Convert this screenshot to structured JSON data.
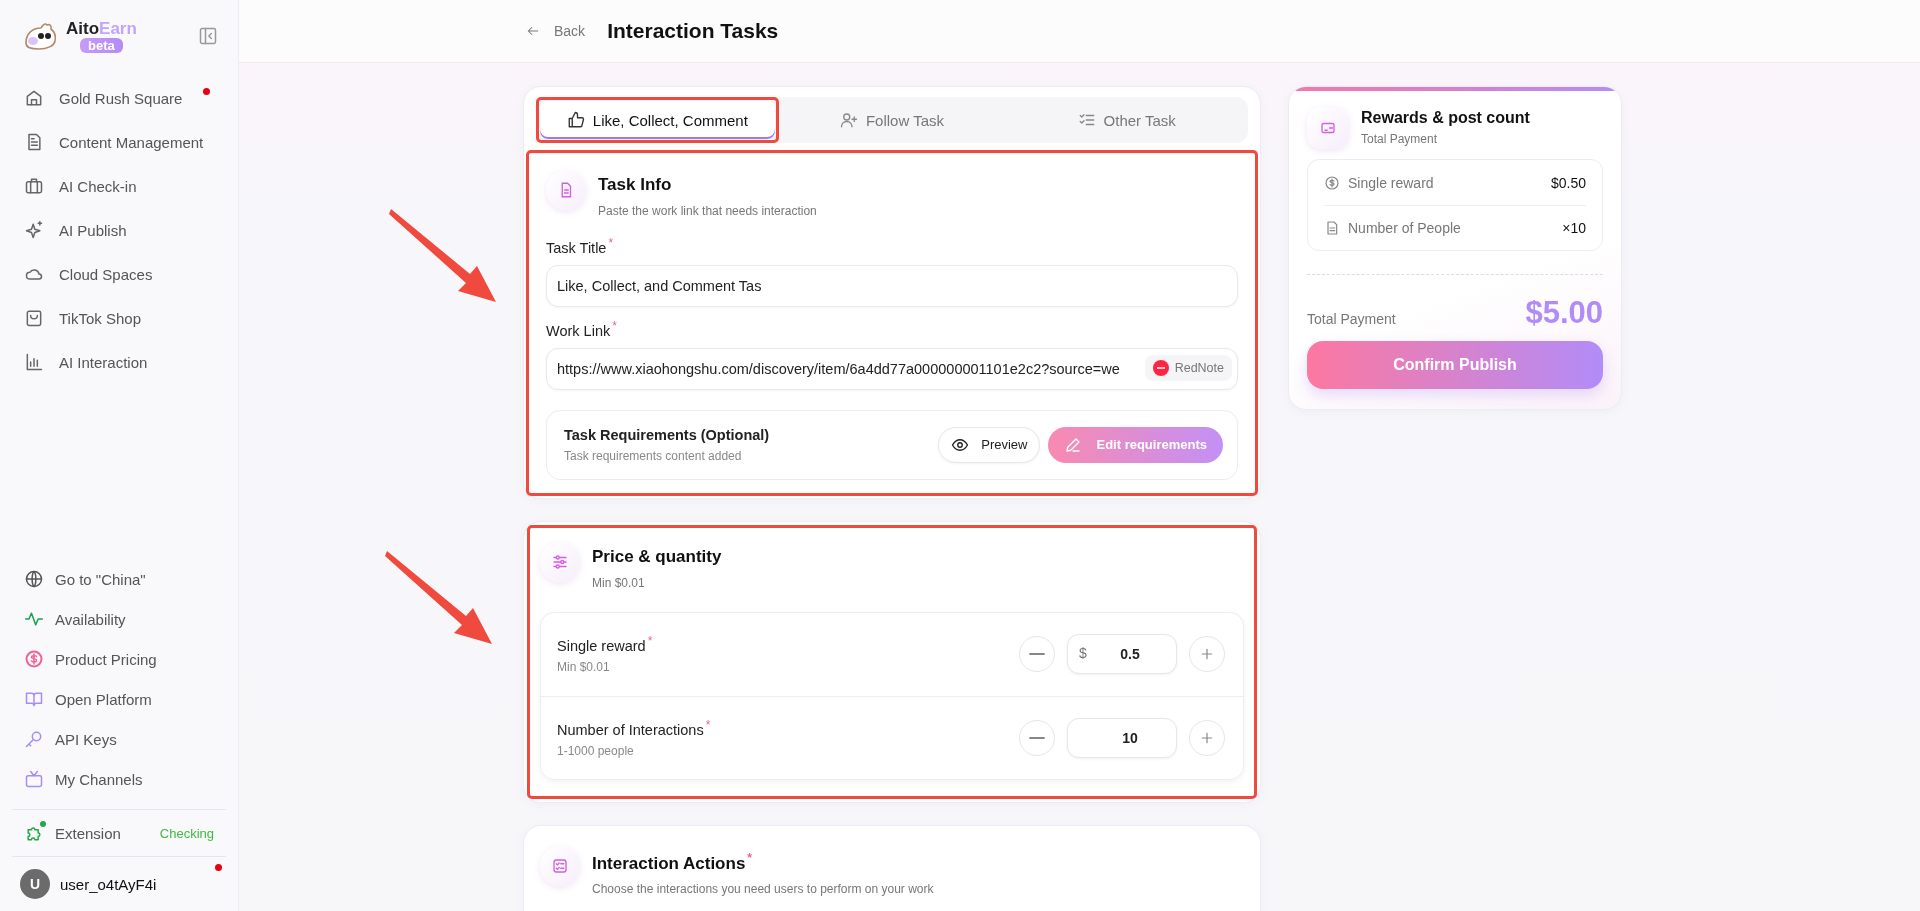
{
  "sidebar": {
    "logo": {
      "word_1": "Aito",
      "word_2": "Earn",
      "badge": "beta"
    },
    "nav_items": [
      {
        "label": "Gold Rush Square",
        "dot": true
      },
      {
        "label": "Content Management",
        "dot": false
      },
      {
        "label": "AI Check-in",
        "dot": false
      },
      {
        "label": "AI Publish",
        "dot": false
      },
      {
        "label": "Cloud Spaces",
        "dot": false
      },
      {
        "label": "TikTok Shop",
        "dot": false
      },
      {
        "label": "AI Interaction",
        "dot": false
      }
    ],
    "bottom_items": [
      {
        "label": "Go to \"China\"",
        "color": "#555555"
      },
      {
        "label": "Availability",
        "color": "#16a34a"
      },
      {
        "label": "Product Pricing",
        "color": "#f06292"
      },
      {
        "label": "Open Platform",
        "color": "#a78bfa"
      },
      {
        "label": "API Keys",
        "color": "#a78bfa"
      },
      {
        "label": "My Channels",
        "color": "#a78bfa"
      }
    ],
    "extension": {
      "label": "Extension",
      "status": "Checking"
    },
    "user": {
      "initial": "U",
      "name": "user_o4tAyF4i",
      "dot": true
    }
  },
  "header": {
    "back": "Back",
    "title": "Interaction Tasks"
  },
  "tabs": [
    {
      "label": "Like, Collect, Comment",
      "selected": true,
      "highlighted": true
    },
    {
      "label": "Follow Task",
      "selected": false,
      "highlighted": false
    },
    {
      "label": "Other Task",
      "selected": false,
      "highlighted": false
    }
  ],
  "task_info": {
    "title": "Task Info",
    "subtitle": "Paste the work link that needs interaction",
    "highlighted": true,
    "arrow": true,
    "fields": [
      {
        "label": "Task Title",
        "required_mark": "*",
        "value": "Like, Collect, and Comment Tas"
      },
      {
        "label": "Work Link",
        "required_mark": "*",
        "value": "https://www.xiaohongshu.com/discovery/item/6a4dd77a000000001101e2c2?source=we",
        "badge": "RedNote"
      }
    ],
    "requirements": {
      "title": "Task Requirements (Optional)",
      "subtitle": "Task requirements content added",
      "preview": "Preview",
      "edit": "Edit requirements"
    }
  },
  "price": {
    "title": "Price & quantity",
    "subtitle": "Min $0.01",
    "highlighted": true,
    "arrow": true,
    "rows": [
      {
        "label": "Single reward",
        "required_mark": "*",
        "hint": "Min $0.01",
        "prefix": "$",
        "value": "0.5"
      },
      {
        "label": "Number of Interactions",
        "required_mark": "*",
        "hint": "1-1000 people",
        "value": "10"
      }
    ]
  },
  "actions": {
    "title": "Interaction Actions",
    "required_mark": "*",
    "subtitle": "Choose the interactions you need users to perform on your work"
  },
  "summary": {
    "title": "Rewards & post count",
    "subtitle": "Total Payment",
    "rows": [
      {
        "label": "Single reward",
        "value": "$0.50"
      },
      {
        "label": "Number of People",
        "value": "×10"
      }
    ],
    "total_label": "Total Payment",
    "total": "$5.00",
    "button": "Confirm Publish"
  }
}
